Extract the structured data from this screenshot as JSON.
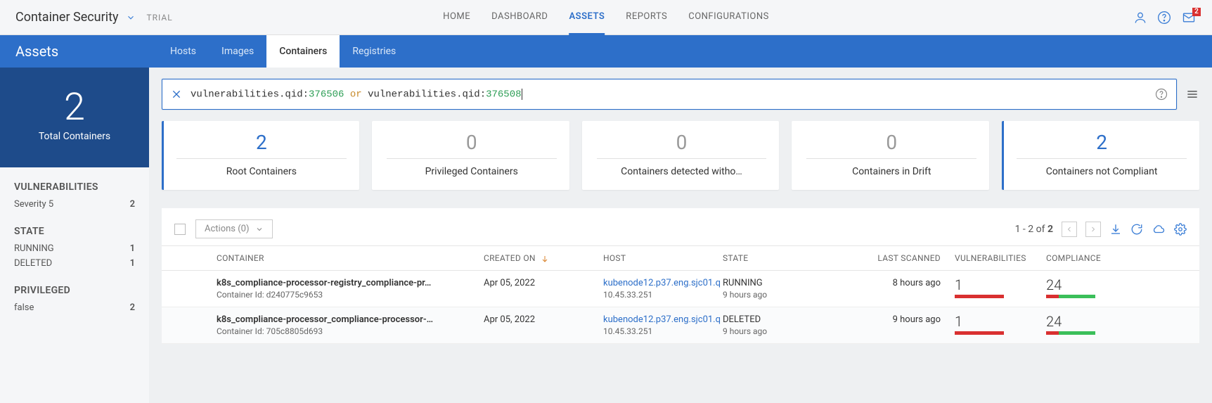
{
  "topbar": {
    "app_title": "Container Security",
    "trial": "TRIAL",
    "nav": {
      "home": "HOME",
      "dashboard": "DASHBOARD",
      "assets": "ASSETS",
      "reports": "REPORTS",
      "configurations": "CONFIGURATIONS"
    },
    "mail_badge": "2"
  },
  "bluebar": {
    "title": "Assets",
    "tabs": {
      "hosts": "Hosts",
      "images": "Images",
      "containers": "Containers",
      "registries": "Registries"
    }
  },
  "sidebar": {
    "count": "2",
    "count_label": "Total Containers",
    "vuln_title": "VULNERABILITIES",
    "vuln_rows": [
      {
        "label": "Severity 5",
        "value": "2"
      }
    ],
    "state_title": "STATE",
    "state_rows": [
      {
        "label": "RUNNING",
        "value": "1"
      },
      {
        "label": "DELETED",
        "value": "1"
      }
    ],
    "priv_title": "PRIVILEGED",
    "priv_rows": [
      {
        "label": "false",
        "value": "2"
      }
    ]
  },
  "search": {
    "q_field_a": "vulnerabilities.qid:",
    "q_val_a": "376506",
    "q_op": " or ",
    "q_field_b": "vulnerabilities.qid:",
    "q_val_b": "376508"
  },
  "cards": [
    {
      "num": "2",
      "label": "Root Containers",
      "nonzero": true
    },
    {
      "num": "0",
      "label": "Privileged Containers",
      "nonzero": false
    },
    {
      "num": "0",
      "label": "Containers detected witho…",
      "nonzero": false
    },
    {
      "num": "0",
      "label": "Containers in Drift",
      "nonzero": false
    },
    {
      "num": "2",
      "label": "Containers not Compliant",
      "nonzero": true
    }
  ],
  "table": {
    "actions_label": "Actions (0)",
    "range": "1 - 2 of",
    "total": "2",
    "headers": {
      "container": "CONTAINER",
      "created": "CREATED ON",
      "host": "HOST",
      "state": "STATE",
      "scanned": "LAST SCANNED",
      "vuln": "VULNERABILITIES",
      "compliance": "COMPLIANCE"
    },
    "rows": [
      {
        "name": "k8s_compliance-processor-registry_compliance-pr…",
        "sub": "Container Id: d240775c9653",
        "created": "Apr 05, 2022",
        "host_name": "kubenode12.p37.eng.sjc01.q",
        "host_ip": "10.45.33.251",
        "state": "RUNNING",
        "state_sub": "9 hours ago",
        "scanned": "8 hours ago",
        "vuln": "1",
        "comp": "24"
      },
      {
        "name": "k8s_compliance-processor_compliance-processor-…",
        "sub": "Container Id: 705c8805d693",
        "created": "Apr 05, 2022",
        "host_name": "kubenode12.p37.eng.sjc01.q",
        "host_ip": "10.45.33.251",
        "state": "DELETED",
        "state_sub": "9 hours ago",
        "scanned": "9 hours ago",
        "vuln": "1",
        "comp": "24"
      }
    ]
  }
}
